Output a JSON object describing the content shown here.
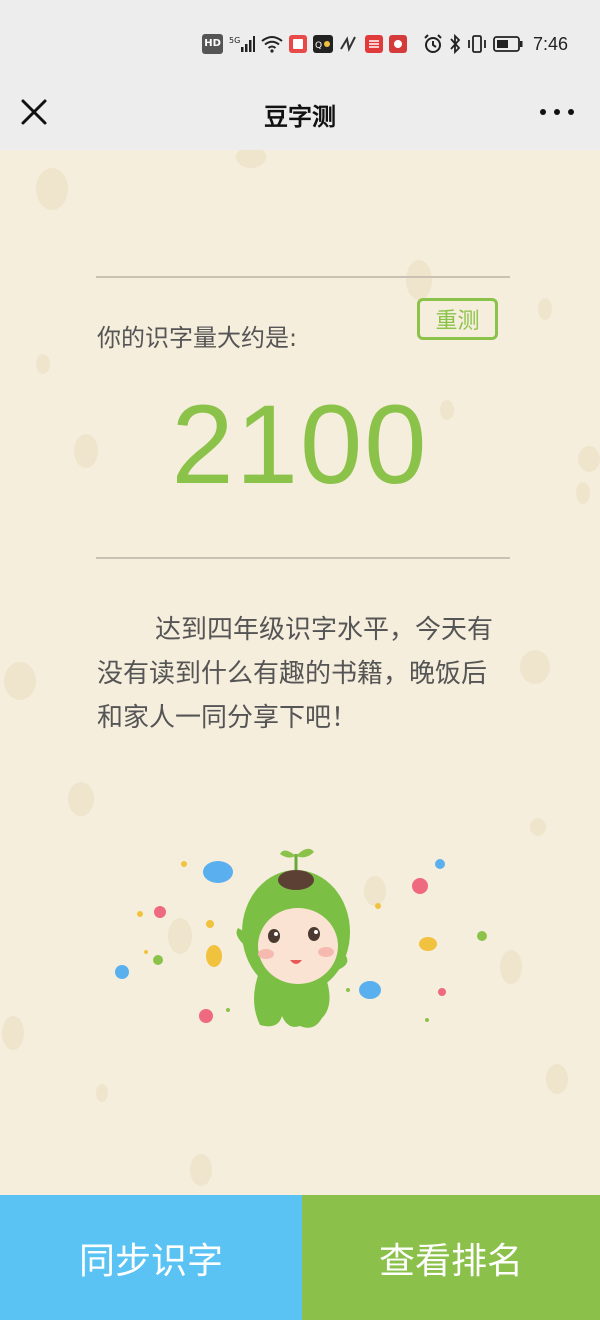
{
  "status_bar": {
    "hd": "HD",
    "signal": "5G",
    "time": "7:46",
    "icons": [
      "hd-badge",
      "signal-icon",
      "wifi-icon",
      "app-notification-icon",
      "app-notification-icon",
      "app-notification-icon",
      "app-notification-icon",
      "app-notification-icon",
      "alarm-icon",
      "bluetooth-icon",
      "vibrate-icon",
      "battery-icon"
    ]
  },
  "nav": {
    "title": "豆字测",
    "close_icon": "close-icon",
    "more_icon": "more-icon"
  },
  "result": {
    "label": "你的识字量大约是:",
    "retest_label": "重测",
    "score": "2100",
    "description": "达到四年级识字水平，今天有没有读到什么有趣的书籍，晚饭后和家人一同分享下吧！"
  },
  "mascot": "mascot-sprout-illustration",
  "actions": {
    "sync_label": "同步识字",
    "rank_label": "查看排名"
  },
  "colors": {
    "accent_green": "#8bc34a",
    "sync_blue": "#5ac3f3",
    "background": "#f6eedd"
  }
}
